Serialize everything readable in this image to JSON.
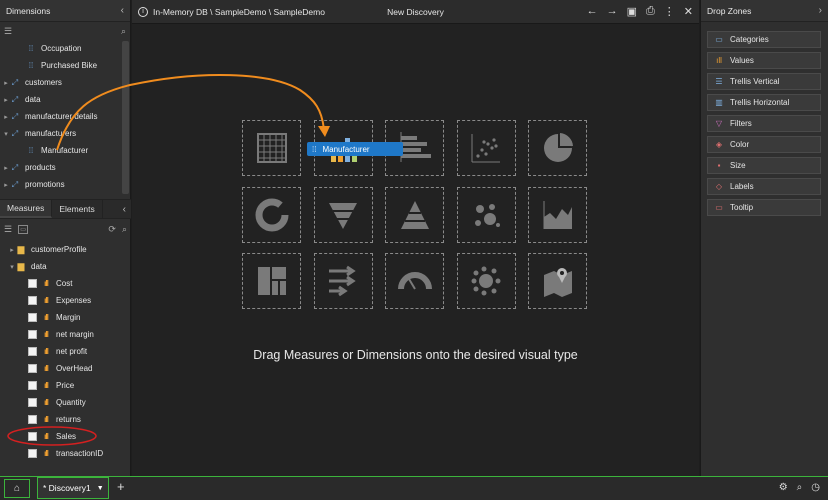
{
  "left": {
    "dimensions_title": "Dimensions",
    "dimensions_tree": [
      {
        "label": "Occupation",
        "level": 2,
        "icon": "dimension-icon"
      },
      {
        "label": "Purchased Bike",
        "level": 2,
        "icon": "dimension-icon"
      },
      {
        "label": "customers",
        "level": 1,
        "icon": "table-icon",
        "expander": "▸"
      },
      {
        "label": "data",
        "level": 1,
        "icon": "table-icon",
        "expander": "▸"
      },
      {
        "label": "manufacturer details",
        "level": 1,
        "icon": "table-icon",
        "expander": "▸"
      },
      {
        "label": "manufacturers",
        "level": 1,
        "icon": "table-icon",
        "expander": "▾"
      },
      {
        "label": "Manufacturer",
        "level": 2,
        "icon": "dimension-icon"
      },
      {
        "label": "products",
        "level": 1,
        "icon": "table-icon",
        "expander": "▸"
      },
      {
        "label": "promotions",
        "level": 1,
        "icon": "table-icon",
        "expander": "▸"
      }
    ],
    "tabs": [
      {
        "label": "Measures",
        "active": true
      },
      {
        "label": "Elements",
        "active": false
      }
    ],
    "measures_tree": [
      {
        "label": "customerProfile",
        "type": "folder",
        "expander": "▸"
      },
      {
        "label": "data",
        "type": "folder",
        "expander": "▾"
      },
      {
        "label": "Cost",
        "type": "measure"
      },
      {
        "label": "Expenses",
        "type": "measure"
      },
      {
        "label": "Margin",
        "type": "measure"
      },
      {
        "label": "net margin",
        "type": "measure"
      },
      {
        "label": "net profit",
        "type": "measure"
      },
      {
        "label": "OverHead",
        "type": "measure"
      },
      {
        "label": "Price",
        "type": "measure"
      },
      {
        "label": "Quantity",
        "type": "measure"
      },
      {
        "label": "returns",
        "type": "measure"
      },
      {
        "label": "Sales",
        "type": "measure",
        "highlighted": true
      },
      {
        "label": "transactionID",
        "type": "measure"
      }
    ]
  },
  "center": {
    "breadcrumb": "In-Memory DB \\ SampleDemo \\ SampleDemo",
    "title": "New Discovery",
    "drag_label": "Manufacturer",
    "hint": "Drag Measures or Dimensions onto the desired visual type",
    "visuals": [
      "grid-icon",
      "bar-chart-icon",
      "horizontal-bar-icon",
      "scatter-icon",
      "pie-icon",
      "donut-icon",
      "funnel-icon",
      "pyramid-icon",
      "bubble-icon",
      "area-icon",
      "treemap-icon",
      "flow-icon",
      "gauge-icon",
      "cluster-icon",
      "map-icon"
    ]
  },
  "right": {
    "title": "Drop Zones",
    "zones": [
      {
        "label": "Categories",
        "icon": "categories-icon"
      },
      {
        "label": "Values",
        "icon": "values-icon"
      },
      {
        "label": "Trellis Vertical",
        "icon": "trellis-vertical-icon"
      },
      {
        "label": "Trellis Horizontal",
        "icon": "trellis-horizontal-icon"
      },
      {
        "label": "Filters",
        "icon": "filter-icon"
      },
      {
        "label": "Color",
        "icon": "color-icon"
      },
      {
        "label": "Size",
        "icon": "size-icon"
      },
      {
        "label": "Labels",
        "icon": "labels-icon"
      },
      {
        "label": "Tooltip",
        "icon": "tooltip-icon"
      }
    ]
  },
  "bottom": {
    "tab_label": "* Discovery1"
  },
  "colors": {
    "accent_green": "#3cb43c",
    "drag_blue": "#1f78c8",
    "arrow_orange": "#f08c1e",
    "highlight_red": "#d42020"
  }
}
